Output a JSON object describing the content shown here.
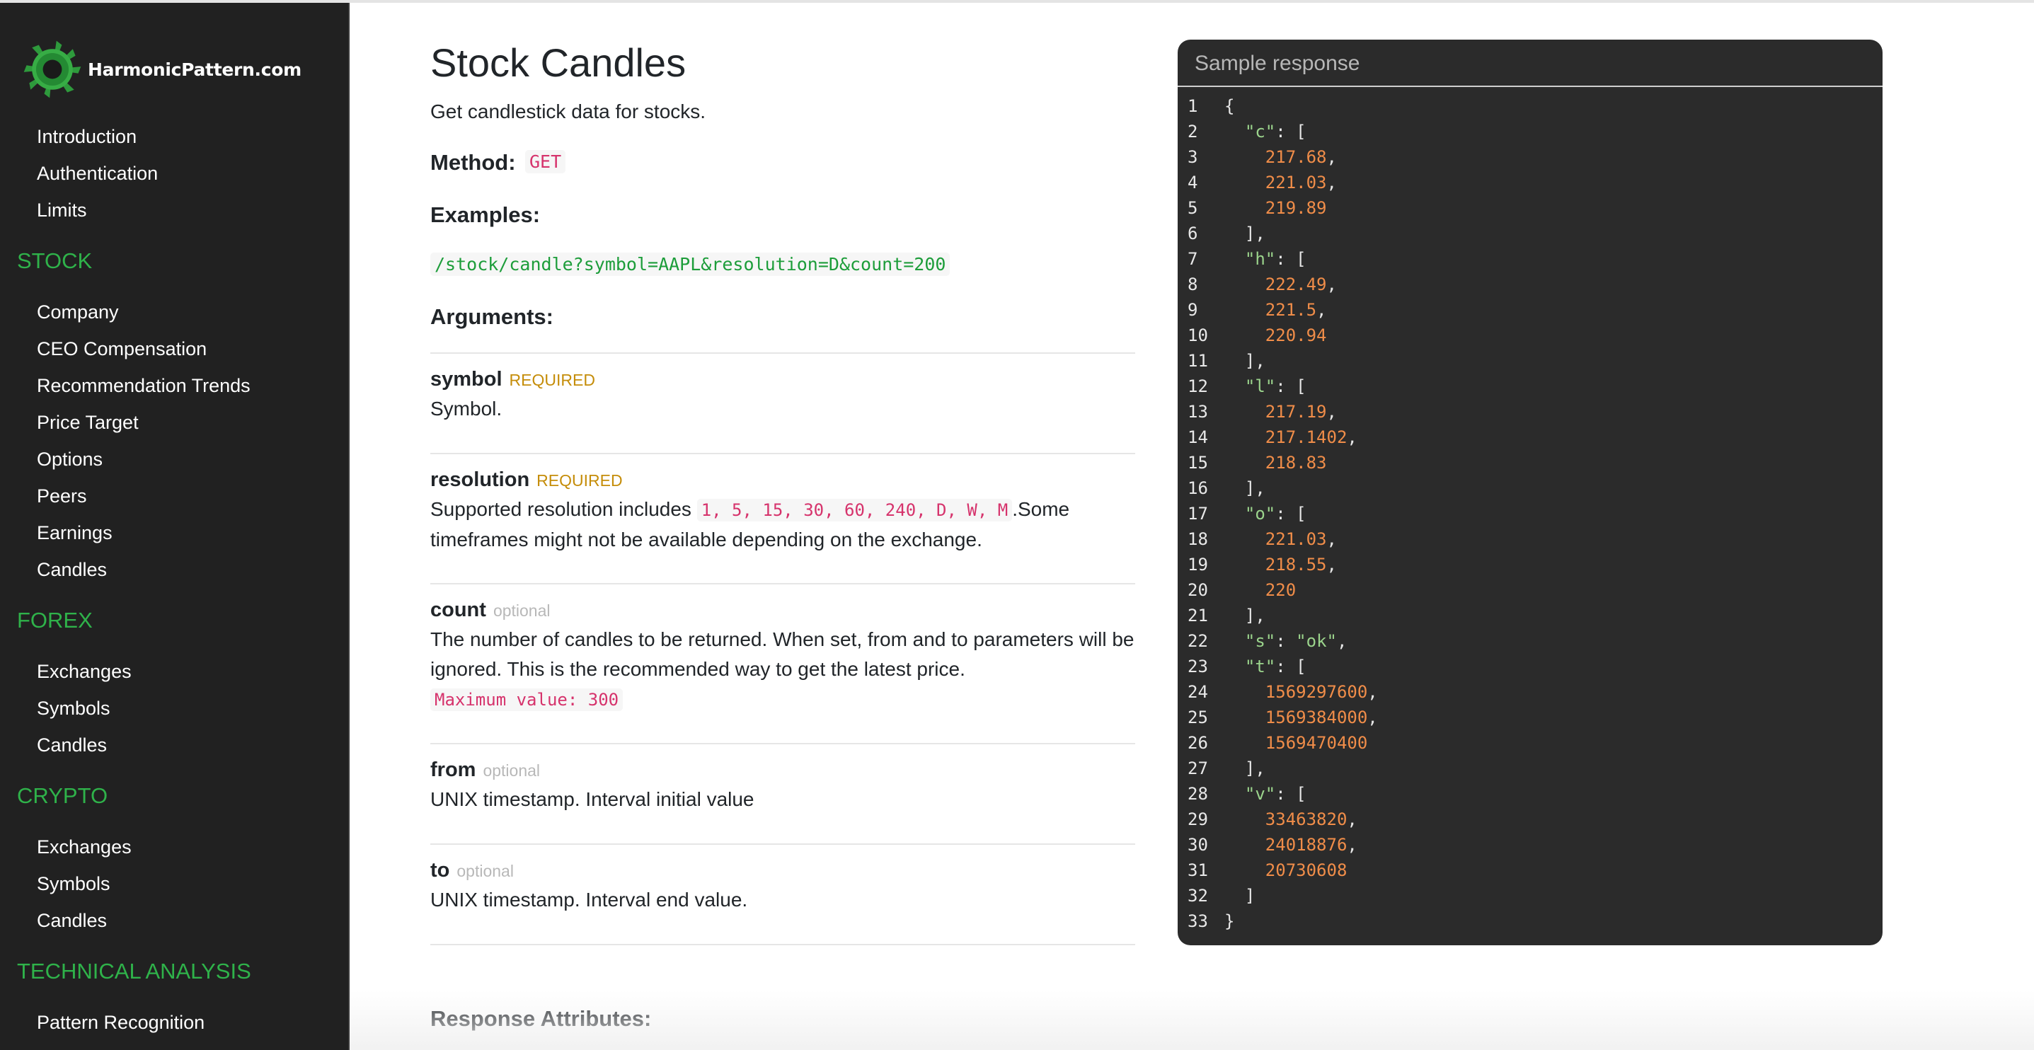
{
  "sidebar": {
    "brand": "HarmonicPattern.com",
    "intro_items": [
      "Introduction",
      "Authentication",
      "Limits"
    ],
    "sections": [
      {
        "title": "STOCK",
        "items": [
          "Company",
          "CEO Compensation",
          "Recommendation Trends",
          "Price Target",
          "Options",
          "Peers",
          "Earnings",
          "Candles"
        ]
      },
      {
        "title": "FOREX",
        "items": [
          "Exchanges",
          "Symbols",
          "Candles"
        ]
      },
      {
        "title": "CRYPTO",
        "items": [
          "Exchanges",
          "Symbols",
          "Candles"
        ]
      },
      {
        "title": "TECHNICAL ANALYSIS",
        "items": [
          "Pattern Recognition"
        ]
      }
    ]
  },
  "main": {
    "title": "Stock Candles",
    "description": "Get candlestick data for stocks.",
    "method_label": "Method:",
    "method": "GET",
    "examples_label": "Examples:",
    "example_url": "/stock/candle?symbol=AAPL&resolution=D&count=200",
    "arguments_label": "Arguments:",
    "arguments": [
      {
        "name": "symbol",
        "badge": "REQUIRED",
        "desc": "Symbol."
      },
      {
        "name": "resolution",
        "badge": "REQUIRED",
        "desc_pre": "Supported resolution includes",
        "desc_code": "1, 5, 15, 30, 60, 240, D, W, M",
        "desc_post": ".Some timeframes might not be available depending on the exchange."
      },
      {
        "name": "count",
        "badge": "optional",
        "desc": "The number of candles to be returned. When set, from and to parameters will be ignored. This is the recommended way to get the latest price.",
        "desc_code": "Maximum value: 300"
      },
      {
        "name": "from",
        "badge": "optional",
        "desc": "UNIX timestamp. Interval initial value"
      },
      {
        "name": "to",
        "badge": "optional",
        "desc": "UNIX timestamp. Interval end value."
      }
    ],
    "response_attributes_label": "Response Attributes:"
  },
  "sample": {
    "title": "Sample response",
    "lines": [
      {
        "n": "1",
        "parts": [
          {
            "t": "txt",
            "v": "{"
          }
        ]
      },
      {
        "n": "2",
        "parts": [
          {
            "t": "txt",
            "v": "  "
          },
          {
            "t": "k",
            "v": "\"c\""
          },
          {
            "t": "txt",
            "v": ": ["
          }
        ]
      },
      {
        "n": "3",
        "parts": [
          {
            "t": "txt",
            "v": "    "
          },
          {
            "t": "n",
            "v": "217.68"
          },
          {
            "t": "txt",
            "v": ","
          }
        ]
      },
      {
        "n": "4",
        "parts": [
          {
            "t": "txt",
            "v": "    "
          },
          {
            "t": "n",
            "v": "221.03"
          },
          {
            "t": "txt",
            "v": ","
          }
        ]
      },
      {
        "n": "5",
        "parts": [
          {
            "t": "txt",
            "v": "    "
          },
          {
            "t": "n",
            "v": "219.89"
          }
        ]
      },
      {
        "n": "6",
        "parts": [
          {
            "t": "txt",
            "v": "  ],"
          }
        ]
      },
      {
        "n": "7",
        "parts": [
          {
            "t": "txt",
            "v": "  "
          },
          {
            "t": "k",
            "v": "\"h\""
          },
          {
            "t": "txt",
            "v": ": ["
          }
        ]
      },
      {
        "n": "8",
        "parts": [
          {
            "t": "txt",
            "v": "    "
          },
          {
            "t": "n",
            "v": "222.49"
          },
          {
            "t": "txt",
            "v": ","
          }
        ]
      },
      {
        "n": "9",
        "parts": [
          {
            "t": "txt",
            "v": "    "
          },
          {
            "t": "n",
            "v": "221.5"
          },
          {
            "t": "txt",
            "v": ","
          }
        ]
      },
      {
        "n": "10",
        "parts": [
          {
            "t": "txt",
            "v": "    "
          },
          {
            "t": "n",
            "v": "220.94"
          }
        ]
      },
      {
        "n": "11",
        "parts": [
          {
            "t": "txt",
            "v": "  ],"
          }
        ]
      },
      {
        "n": "12",
        "parts": [
          {
            "t": "txt",
            "v": "  "
          },
          {
            "t": "k",
            "v": "\"l\""
          },
          {
            "t": "txt",
            "v": ": ["
          }
        ]
      },
      {
        "n": "13",
        "parts": [
          {
            "t": "txt",
            "v": "    "
          },
          {
            "t": "n",
            "v": "217.19"
          },
          {
            "t": "txt",
            "v": ","
          }
        ]
      },
      {
        "n": "14",
        "parts": [
          {
            "t": "txt",
            "v": "    "
          },
          {
            "t": "n",
            "v": "217.1402"
          },
          {
            "t": "txt",
            "v": ","
          }
        ]
      },
      {
        "n": "15",
        "parts": [
          {
            "t": "txt",
            "v": "    "
          },
          {
            "t": "n",
            "v": "218.83"
          }
        ]
      },
      {
        "n": "16",
        "parts": [
          {
            "t": "txt",
            "v": "  ],"
          }
        ]
      },
      {
        "n": "17",
        "parts": [
          {
            "t": "txt",
            "v": "  "
          },
          {
            "t": "k",
            "v": "\"o\""
          },
          {
            "t": "txt",
            "v": ": ["
          }
        ]
      },
      {
        "n": "18",
        "parts": [
          {
            "t": "txt",
            "v": "    "
          },
          {
            "t": "n",
            "v": "221.03"
          },
          {
            "t": "txt",
            "v": ","
          }
        ]
      },
      {
        "n": "19",
        "parts": [
          {
            "t": "txt",
            "v": "    "
          },
          {
            "t": "n",
            "v": "218.55"
          },
          {
            "t": "txt",
            "v": ","
          }
        ]
      },
      {
        "n": "20",
        "parts": [
          {
            "t": "txt",
            "v": "    "
          },
          {
            "t": "n",
            "v": "220"
          }
        ]
      },
      {
        "n": "21",
        "parts": [
          {
            "t": "txt",
            "v": "  ],"
          }
        ]
      },
      {
        "n": "22",
        "parts": [
          {
            "t": "txt",
            "v": "  "
          },
          {
            "t": "k",
            "v": "\"s\""
          },
          {
            "t": "txt",
            "v": ": "
          },
          {
            "t": "s",
            "v": "\"ok\""
          },
          {
            "t": "txt",
            "v": ","
          }
        ]
      },
      {
        "n": "23",
        "parts": [
          {
            "t": "txt",
            "v": "  "
          },
          {
            "t": "k",
            "v": "\"t\""
          },
          {
            "t": "txt",
            "v": ": ["
          }
        ]
      },
      {
        "n": "24",
        "parts": [
          {
            "t": "txt",
            "v": "    "
          },
          {
            "t": "n",
            "v": "1569297600"
          },
          {
            "t": "txt",
            "v": ","
          }
        ]
      },
      {
        "n": "25",
        "parts": [
          {
            "t": "txt",
            "v": "    "
          },
          {
            "t": "n",
            "v": "1569384000"
          },
          {
            "t": "txt",
            "v": ","
          }
        ]
      },
      {
        "n": "26",
        "parts": [
          {
            "t": "txt",
            "v": "    "
          },
          {
            "t": "n",
            "v": "1569470400"
          }
        ]
      },
      {
        "n": "27",
        "parts": [
          {
            "t": "txt",
            "v": "  ],"
          }
        ]
      },
      {
        "n": "28",
        "parts": [
          {
            "t": "txt",
            "v": "  "
          },
          {
            "t": "k",
            "v": "\"v\""
          },
          {
            "t": "txt",
            "v": ": ["
          }
        ]
      },
      {
        "n": "29",
        "parts": [
          {
            "t": "txt",
            "v": "    "
          },
          {
            "t": "n",
            "v": "33463820"
          },
          {
            "t": "txt",
            "v": ","
          }
        ]
      },
      {
        "n": "30",
        "parts": [
          {
            "t": "txt",
            "v": "    "
          },
          {
            "t": "n",
            "v": "24018876"
          },
          {
            "t": "txt",
            "v": ","
          }
        ]
      },
      {
        "n": "31",
        "parts": [
          {
            "t": "txt",
            "v": "    "
          },
          {
            "t": "n",
            "v": "20730608"
          }
        ]
      },
      {
        "n": "32",
        "parts": [
          {
            "t": "txt",
            "v": "  ]"
          }
        ]
      },
      {
        "n": "33",
        "parts": [
          {
            "t": "txt",
            "v": "}"
          }
        ]
      }
    ]
  },
  "colors": {
    "sidebar_bg": "#212121",
    "section_green": "#2fb24a",
    "required_gold": "#c58d0a",
    "optional_gray": "#b8b8b8",
    "code_pink": "#d6336c",
    "url_green": "#1d9d3a",
    "json_key": "#9bd48c",
    "json_number": "#f08d49",
    "panel_bg": "#2b2b2b"
  }
}
